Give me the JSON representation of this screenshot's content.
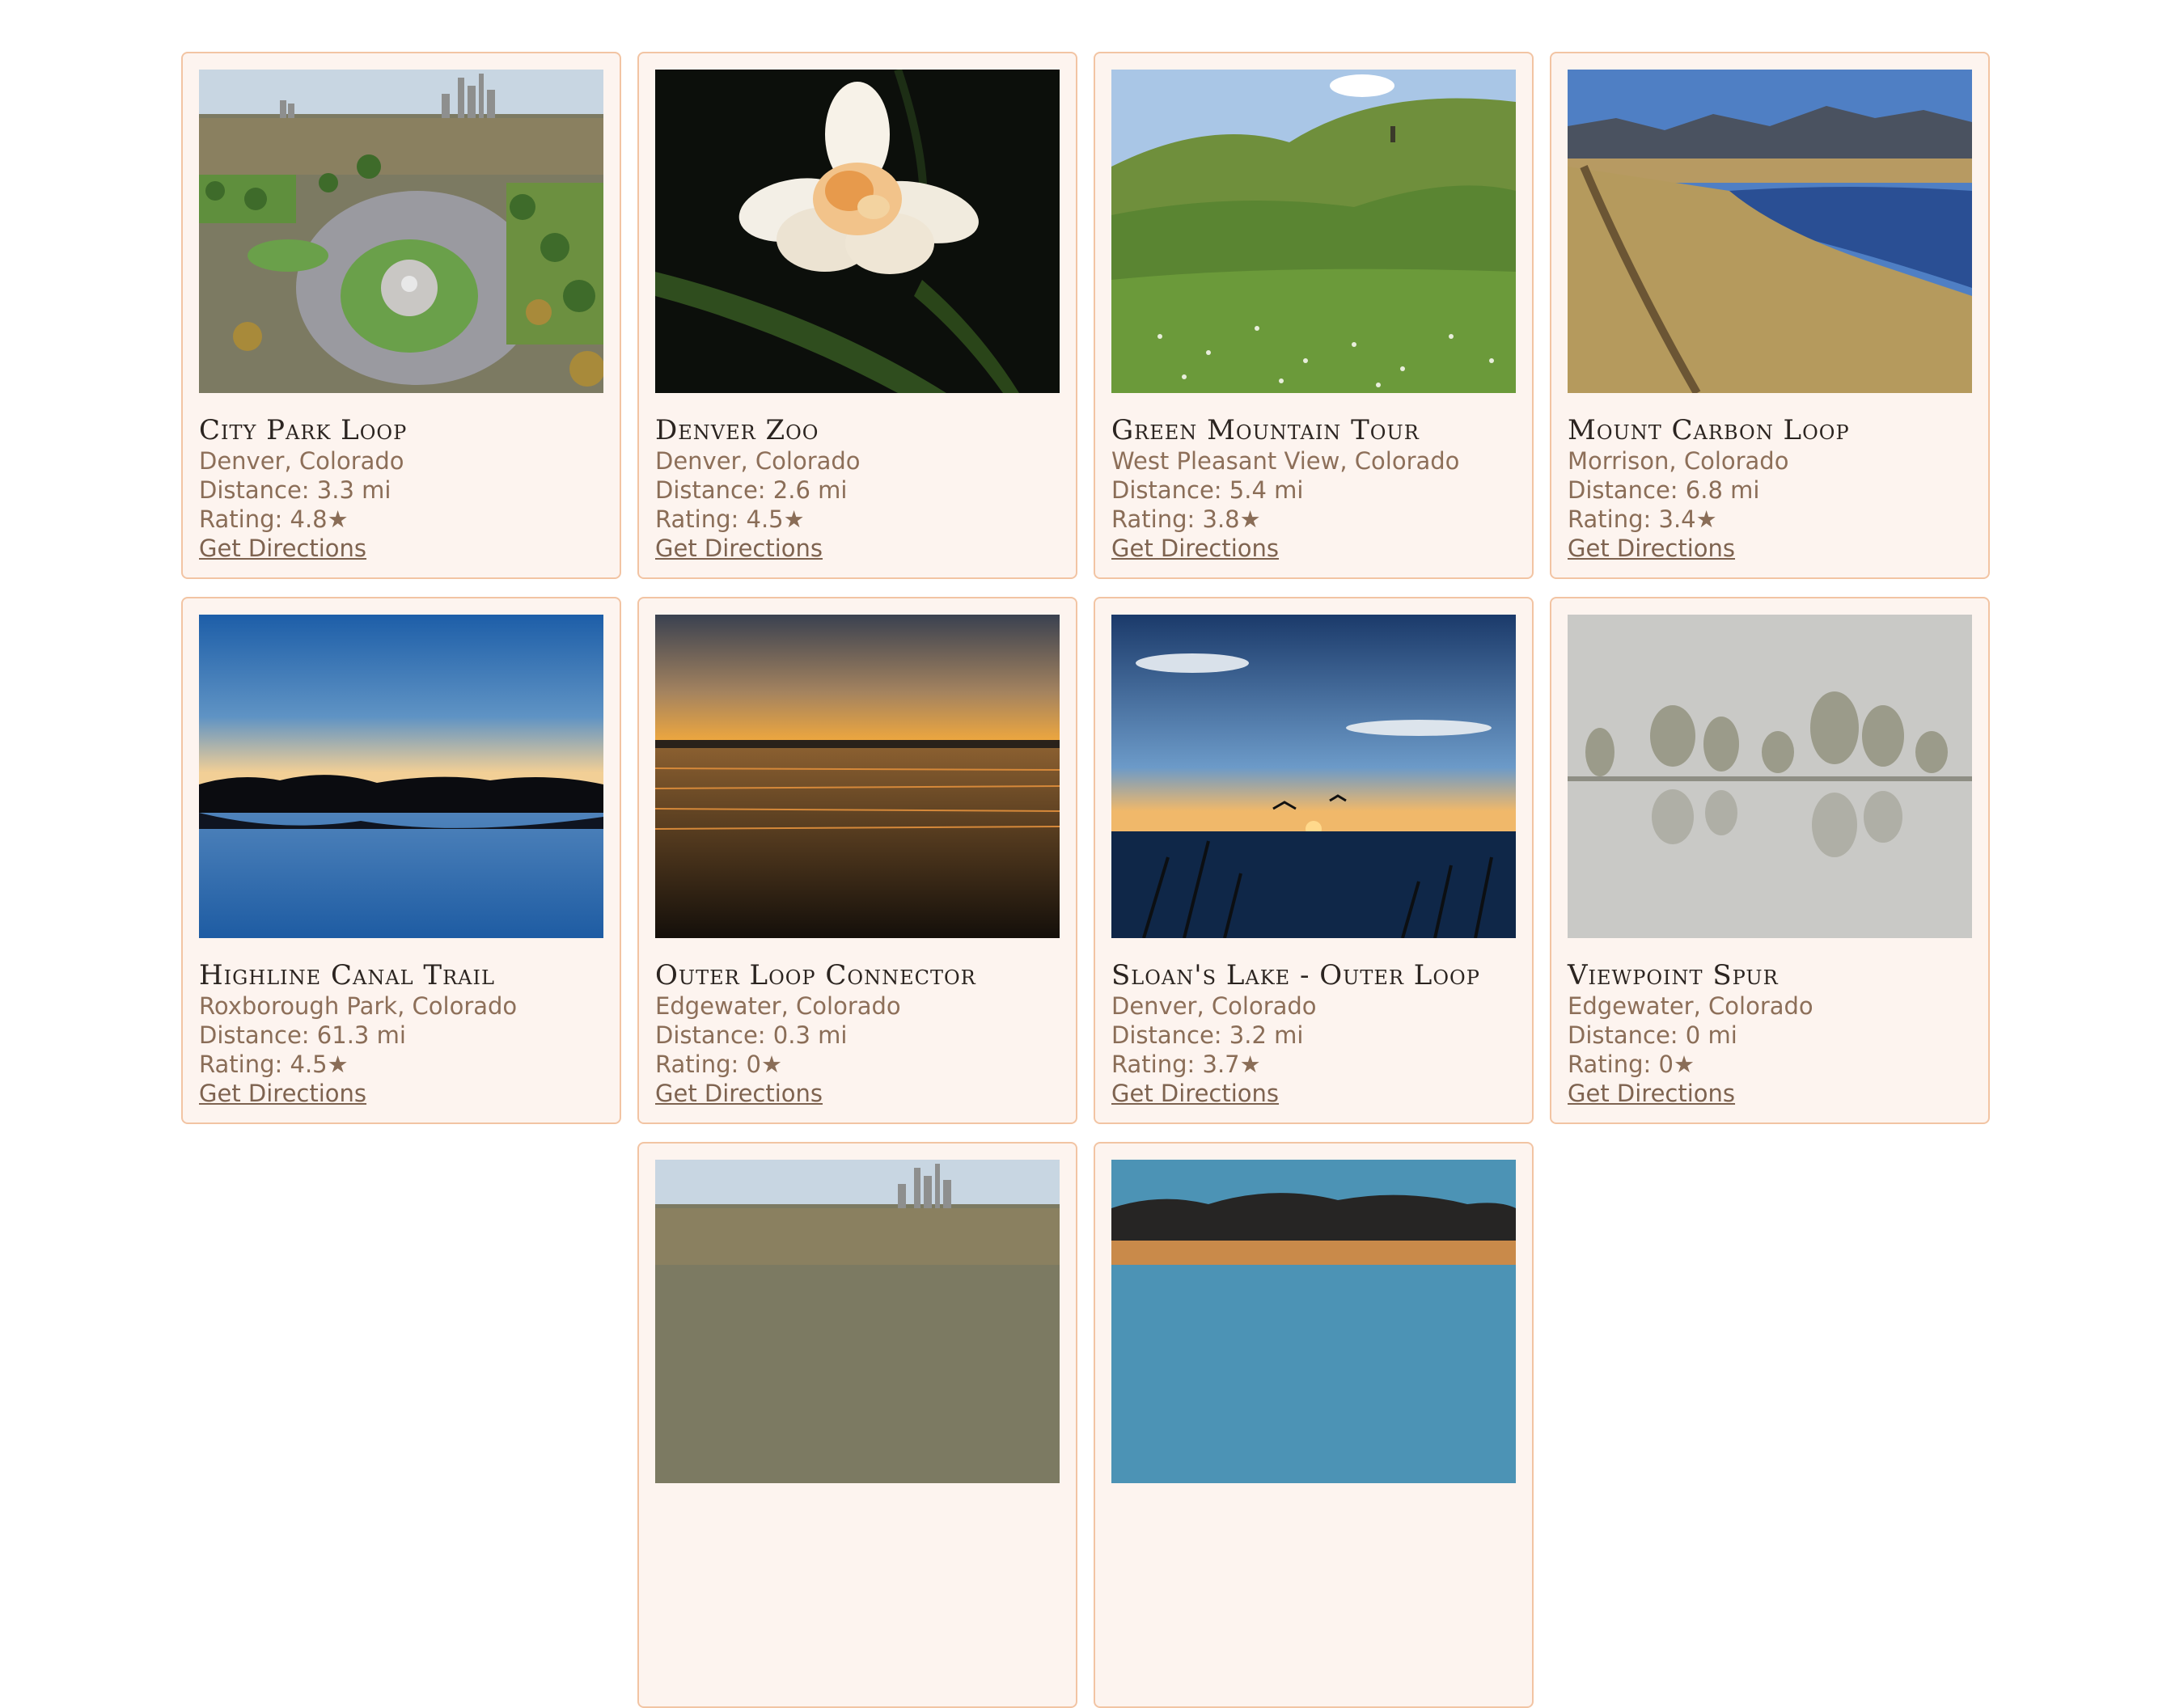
{
  "trails": [
    {
      "name": "City Park Loop",
      "location": "Denver, Colorado",
      "distance": "Distance: 3.3 mi",
      "rating": "Rating: 4.8★",
      "link": "Get Directions",
      "photo": "city-aerial"
    },
    {
      "name": "Denver Zoo",
      "location": "Denver, Colorado",
      "distance": "Distance: 2.6 mi",
      "rating": "Rating: 4.5★",
      "link": "Get Directions",
      "photo": "flower"
    },
    {
      "name": "Green Mountain Tour",
      "location": "West Pleasant View, Colorado",
      "distance": "Distance: 5.4 mi",
      "rating": "Rating: 3.8★",
      "link": "Get Directions",
      "photo": "green-hills"
    },
    {
      "name": "Mount Carbon Loop",
      "location": "Morrison, Colorado",
      "distance": "Distance: 6.8 mi",
      "rating": "Rating: 3.4★",
      "link": "Get Directions",
      "photo": "mountain-lake"
    },
    {
      "name": "Highline Canal Trail",
      "location": "Roxborough Park, Colorado",
      "distance": "Distance: 61.3 mi",
      "rating": "Rating: 4.5★",
      "link": "Get Directions",
      "photo": "blue-sunset"
    },
    {
      "name": "Outer Loop Connector",
      "location": "Edgewater, Colorado",
      "distance": "Distance: 0.3 mi",
      "rating": "Rating: 0★",
      "link": "Get Directions",
      "photo": "orange-sunset"
    },
    {
      "name": "Sloan's Lake - Outer Loop",
      "location": "Denver, Colorado",
      "distance": "Distance: 3.2 mi",
      "rating": "Rating: 3.7★",
      "link": "Get Directions",
      "photo": "reed-sunset"
    },
    {
      "name": "Viewpoint Spur",
      "location": "Edgewater, Colorado",
      "distance": "Distance: 0 mi",
      "rating": "Rating: 0★",
      "link": "Get Directions",
      "photo": "fog-trees"
    }
  ],
  "partial_cards": [
    {
      "photo": "city-aerial"
    },
    {
      "photo": "cloud-dusk"
    }
  ],
  "colors": {
    "card_background": "#fdf4ef",
    "card_border": "#f2c4a3",
    "title_text": "#2b2420",
    "meta_text": "#8a6d57"
  }
}
